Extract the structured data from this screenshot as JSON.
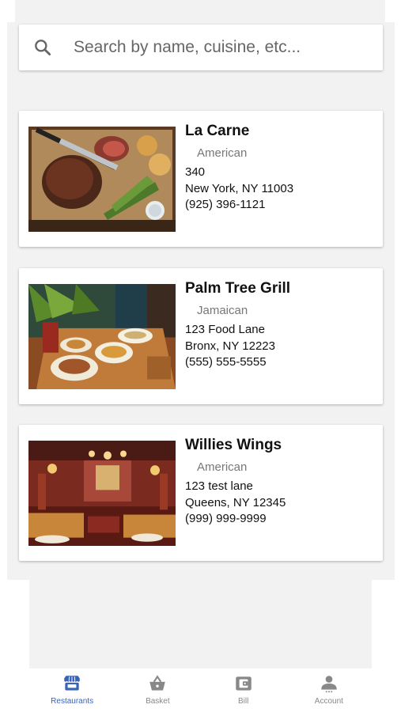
{
  "search": {
    "placeholder": "Search by name, cuisine, etc..."
  },
  "restaurants": [
    {
      "name": "La Carne",
      "cuisine": "American",
      "address_line1": "340",
      "address_line2": "New York, NY 11003",
      "phone": "(925) 396-1121",
      "image": "steak-board-photo"
    },
    {
      "name": "Palm Tree Grill",
      "cuisine": "Jamaican",
      "address_line1": "123 Food Lane",
      "address_line2": "Bronx, NY 12223",
      "phone": "(555) 555-5555",
      "image": "dining-table-photo"
    },
    {
      "name": "Willies Wings",
      "cuisine": "American",
      "address_line1": "123 test lane",
      "address_line2": "Queens, NY 12345",
      "phone": "(999) 999-9999",
      "image": "restaurant-interior-photo"
    }
  ],
  "tabs": [
    {
      "label": "Restaurants",
      "icon": "storefront-icon",
      "active": true
    },
    {
      "label": "Basket",
      "icon": "basket-icon",
      "active": false
    },
    {
      "label": "Bill",
      "icon": "wallet-icon",
      "active": false
    },
    {
      "label": "Account",
      "icon": "account-icon",
      "active": false
    }
  ],
  "colors": {
    "accent": "#3a63b8",
    "inactive": "#888888",
    "background": "#f2f2f2"
  }
}
